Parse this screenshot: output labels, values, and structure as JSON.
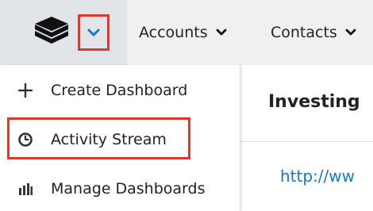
{
  "nav": {
    "logo_icon": "stacked-layers-icon",
    "logo_menu_icon": "chevron-down-icon",
    "items": [
      {
        "label": "Accounts",
        "icon": "chevron-down-icon"
      },
      {
        "label": "Contacts",
        "icon": "chevron-down-icon"
      }
    ]
  },
  "menu": {
    "items": [
      {
        "label": "Create Dashboard",
        "icon": "plus-icon"
      },
      {
        "label": "Activity Stream",
        "icon": "clock-icon"
      },
      {
        "label": "Manage Dashboards",
        "icon": "bar-chart-icon"
      }
    ]
  },
  "content": {
    "heading": "Investing",
    "link": "http://ww"
  },
  "colors": {
    "highlight": "#e0392b",
    "accent": "#1a78c2",
    "nav_bg": "#eef0f2"
  }
}
